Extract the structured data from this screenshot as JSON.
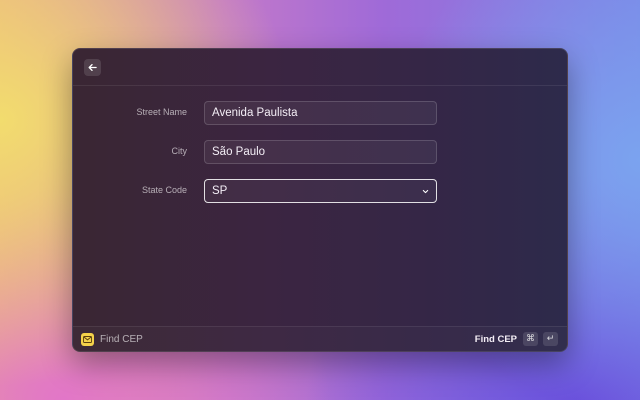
{
  "form": {
    "fields": [
      {
        "label": "Street Name",
        "value": "Avenida Paulista"
      },
      {
        "label": "City",
        "value": "São Paulo"
      },
      {
        "label": "State Code",
        "value": "SP"
      }
    ]
  },
  "footer": {
    "extension_name": "Find CEP",
    "action_label": "Find CEP",
    "shortcut": [
      "⌘",
      "↵"
    ]
  },
  "icons": {
    "back": "arrow-left-icon",
    "extension": "envelope-icon",
    "dropdown": "chevron-down-icon"
  },
  "colors": {
    "extension_icon": "#f5d24a"
  }
}
